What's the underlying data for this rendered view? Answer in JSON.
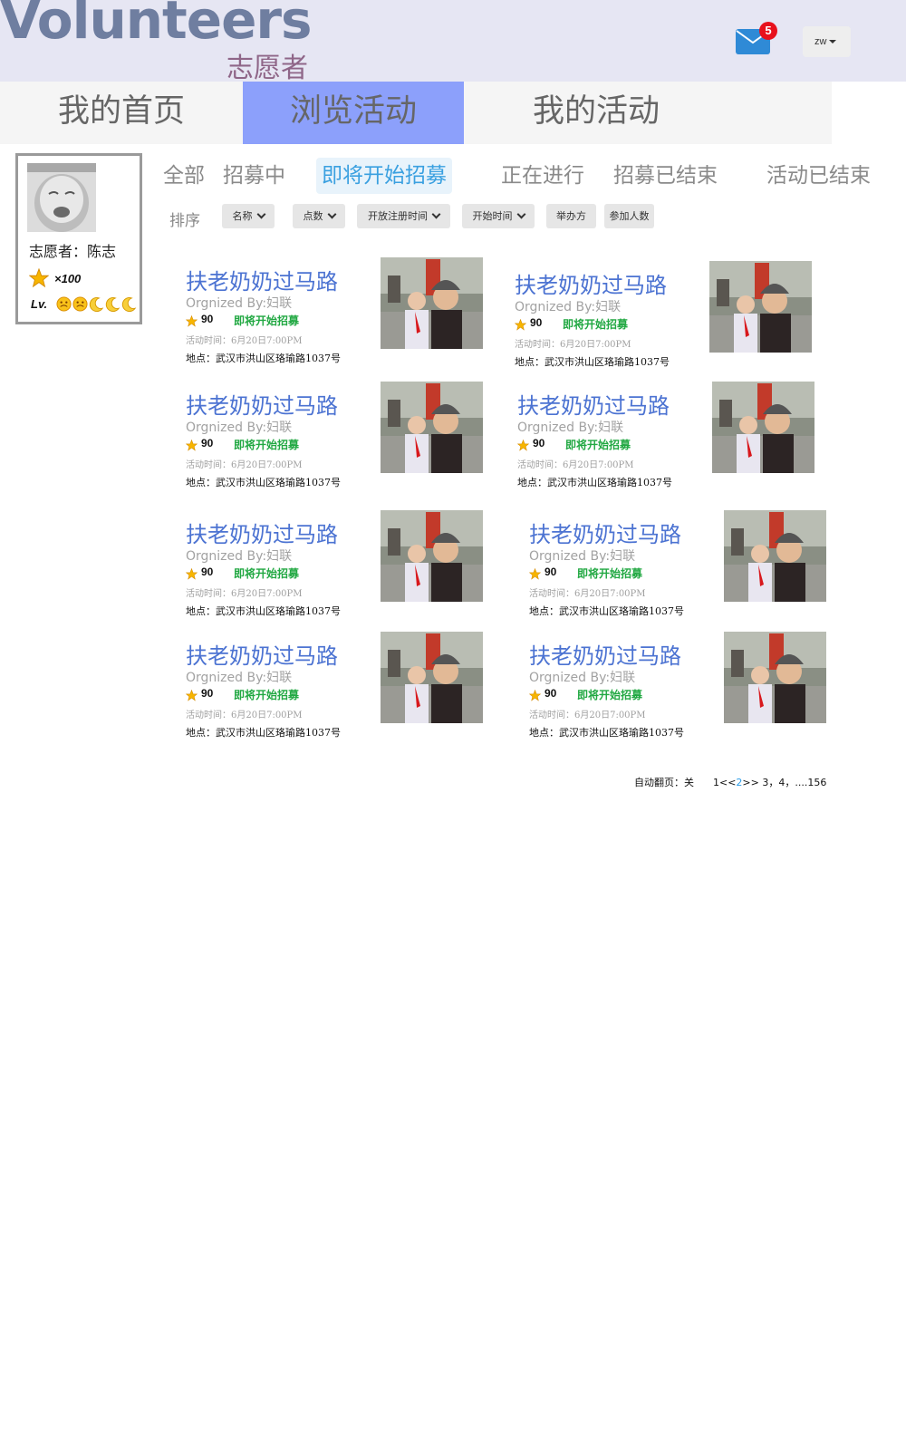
{
  "header": {
    "logo": "Volunteers",
    "logo_sub": "志愿者",
    "unread_count": "5",
    "user_menu_label": "zw"
  },
  "nav": {
    "tabs": [
      {
        "label": "我的首页"
      },
      {
        "label": "浏览活动"
      },
      {
        "label": "我的活动"
      }
    ],
    "active_index": 1
  },
  "profile": {
    "name": "志愿者：陈志",
    "points": "×100",
    "level_label": "Lv."
  },
  "filters": {
    "items": [
      {
        "label": "全部"
      },
      {
        "label": "招募中"
      },
      {
        "label": "即将开始招募"
      },
      {
        "label": "正在进行"
      },
      {
        "label": "招募已结束"
      },
      {
        "label": "活动已结束"
      }
    ],
    "active_index": 2
  },
  "sort": {
    "label": "排序",
    "buttons": [
      {
        "label": "名称"
      },
      {
        "label": "点数"
      },
      {
        "label": "开放注册时间"
      },
      {
        "label": "开始时间"
      },
      {
        "label": "举办方"
      },
      {
        "label": "参加人数"
      }
    ]
  },
  "activities": [
    {
      "title": "扶老奶奶过马路",
      "org": "Orgnized By:妇联",
      "points": "90",
      "status": "即将开始招募",
      "time": "活动时间：6月20日7:00PM",
      "location": "地点：武汉市洪山区珞瑜路1037号"
    },
    {
      "title": "扶老奶奶过马路",
      "org": "Orgnized By:妇联",
      "points": "90",
      "status": "即将开始招募",
      "time": "活动时间：6月20日7:00PM",
      "location": "地点：武汉市洪山区珞瑜路1037号"
    },
    {
      "title": "扶老奶奶过马路",
      "org": "Orgnized By:妇联",
      "points": "90",
      "status": "即将开始招募",
      "time": "活动时间：6月20日7:00PM",
      "location": "地点：武汉市洪山区珞瑜路1037号"
    },
    {
      "title": "扶老奶奶过马路",
      "org": "Orgnized By:妇联",
      "points": "90",
      "status": "即将开始招募",
      "time": "活动时间：6月20日7:00PM",
      "location": "地点：武汉市洪山区珞瑜路1037号"
    },
    {
      "title": "扶老奶奶过马路",
      "org": "Orgnized By:妇联",
      "points": "90",
      "status": "即将开始招募",
      "time": "活动时间：6月20日7:00PM",
      "location": "地点：武汉市洪山区珞瑜路1037号"
    },
    {
      "title": "扶老奶奶过马路",
      "org": "Orgnized By:妇联",
      "points": "90",
      "status": "即将开始招募",
      "time": "活动时间：6月20日7:00PM",
      "location": "地点：武汉市洪山区珞瑜路1037号"
    },
    {
      "title": "扶老奶奶过马路",
      "org": "Orgnized By:妇联",
      "points": "90",
      "status": "即将开始招募",
      "time": "活动时间：6月20日7:00PM",
      "location": "地点：武汉市洪山区珞瑜路1037号"
    },
    {
      "title": "扶老奶奶过马路",
      "org": "Orgnized By:妇联",
      "points": "90",
      "status": "即将开始招募",
      "time": "活动时间：6月20日7:00PM",
      "location": "地点：武汉市洪山区珞瑜路1037号"
    }
  ],
  "pagination": {
    "auto_label": "自动翻页：关",
    "prefix": "1<<",
    "current": "2",
    "suffix": ">> 3，4，....156"
  },
  "colors": {
    "nav_active": "#8ca0fb",
    "title_blue": "#4c73d2",
    "status_green": "#21a842",
    "header_bg": "#e6e6f3"
  }
}
